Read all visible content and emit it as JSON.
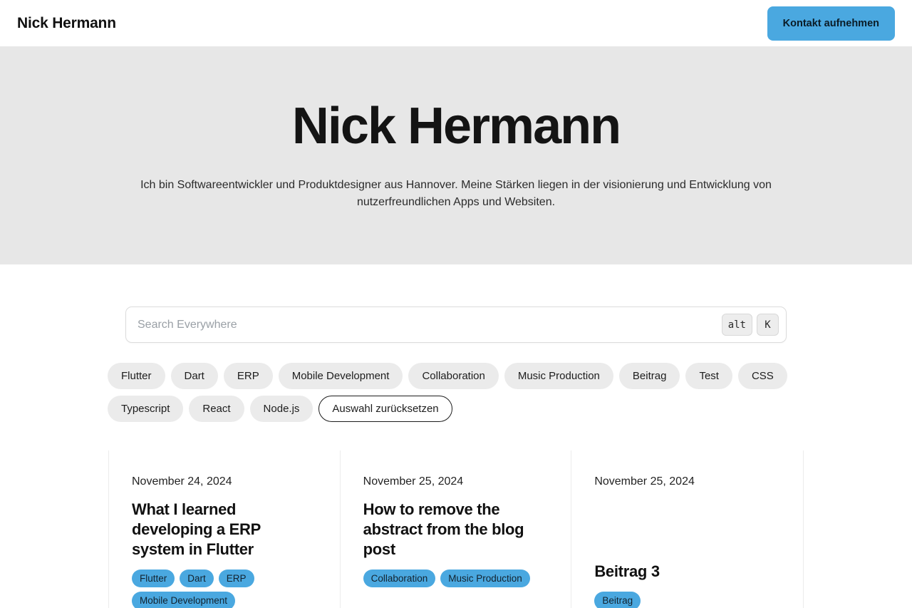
{
  "header": {
    "brand": "Nick Hermann",
    "contact_button": "Kontakt aufnehmen",
    "accent_color": "#4aa8e0"
  },
  "hero": {
    "title": "Nick Hermann",
    "subtitle": "Ich bin Softwareentwickler und Produktdesigner aus Hannover. Meine Stärken liegen in der visionierung und Entwicklung von nutzerfreundlichen Apps und Websiten.",
    "background_color": "#e7e7e7"
  },
  "search": {
    "placeholder": "Search Everywhere",
    "value": "",
    "shortcut_keys": [
      "alt",
      "K"
    ]
  },
  "filters": {
    "tags": [
      "Flutter",
      "Dart",
      "ERP",
      "Mobile Development",
      "Collaboration",
      "Music Production",
      "Beitrag",
      "Test",
      "CSS",
      "Typescript",
      "React",
      "Node.js"
    ],
    "reset_label": "Auswahl zurücksetzen"
  },
  "posts": [
    {
      "date": "November 24, 2024",
      "title": "What I learned developing a ERP system in Flutter",
      "tags": [
        "Flutter",
        "Dart",
        "ERP",
        "Mobile Development"
      ],
      "title_bottom": false
    },
    {
      "date": "November 25, 2024",
      "title": "How to remove the abstract from the blog post",
      "tags": [
        "Collaboration",
        "Music Production"
      ],
      "title_bottom": false
    },
    {
      "date": "November 25, 2024",
      "title": "Beitrag 3",
      "tags": [
        "Beitrag"
      ],
      "title_bottom": true
    }
  ]
}
